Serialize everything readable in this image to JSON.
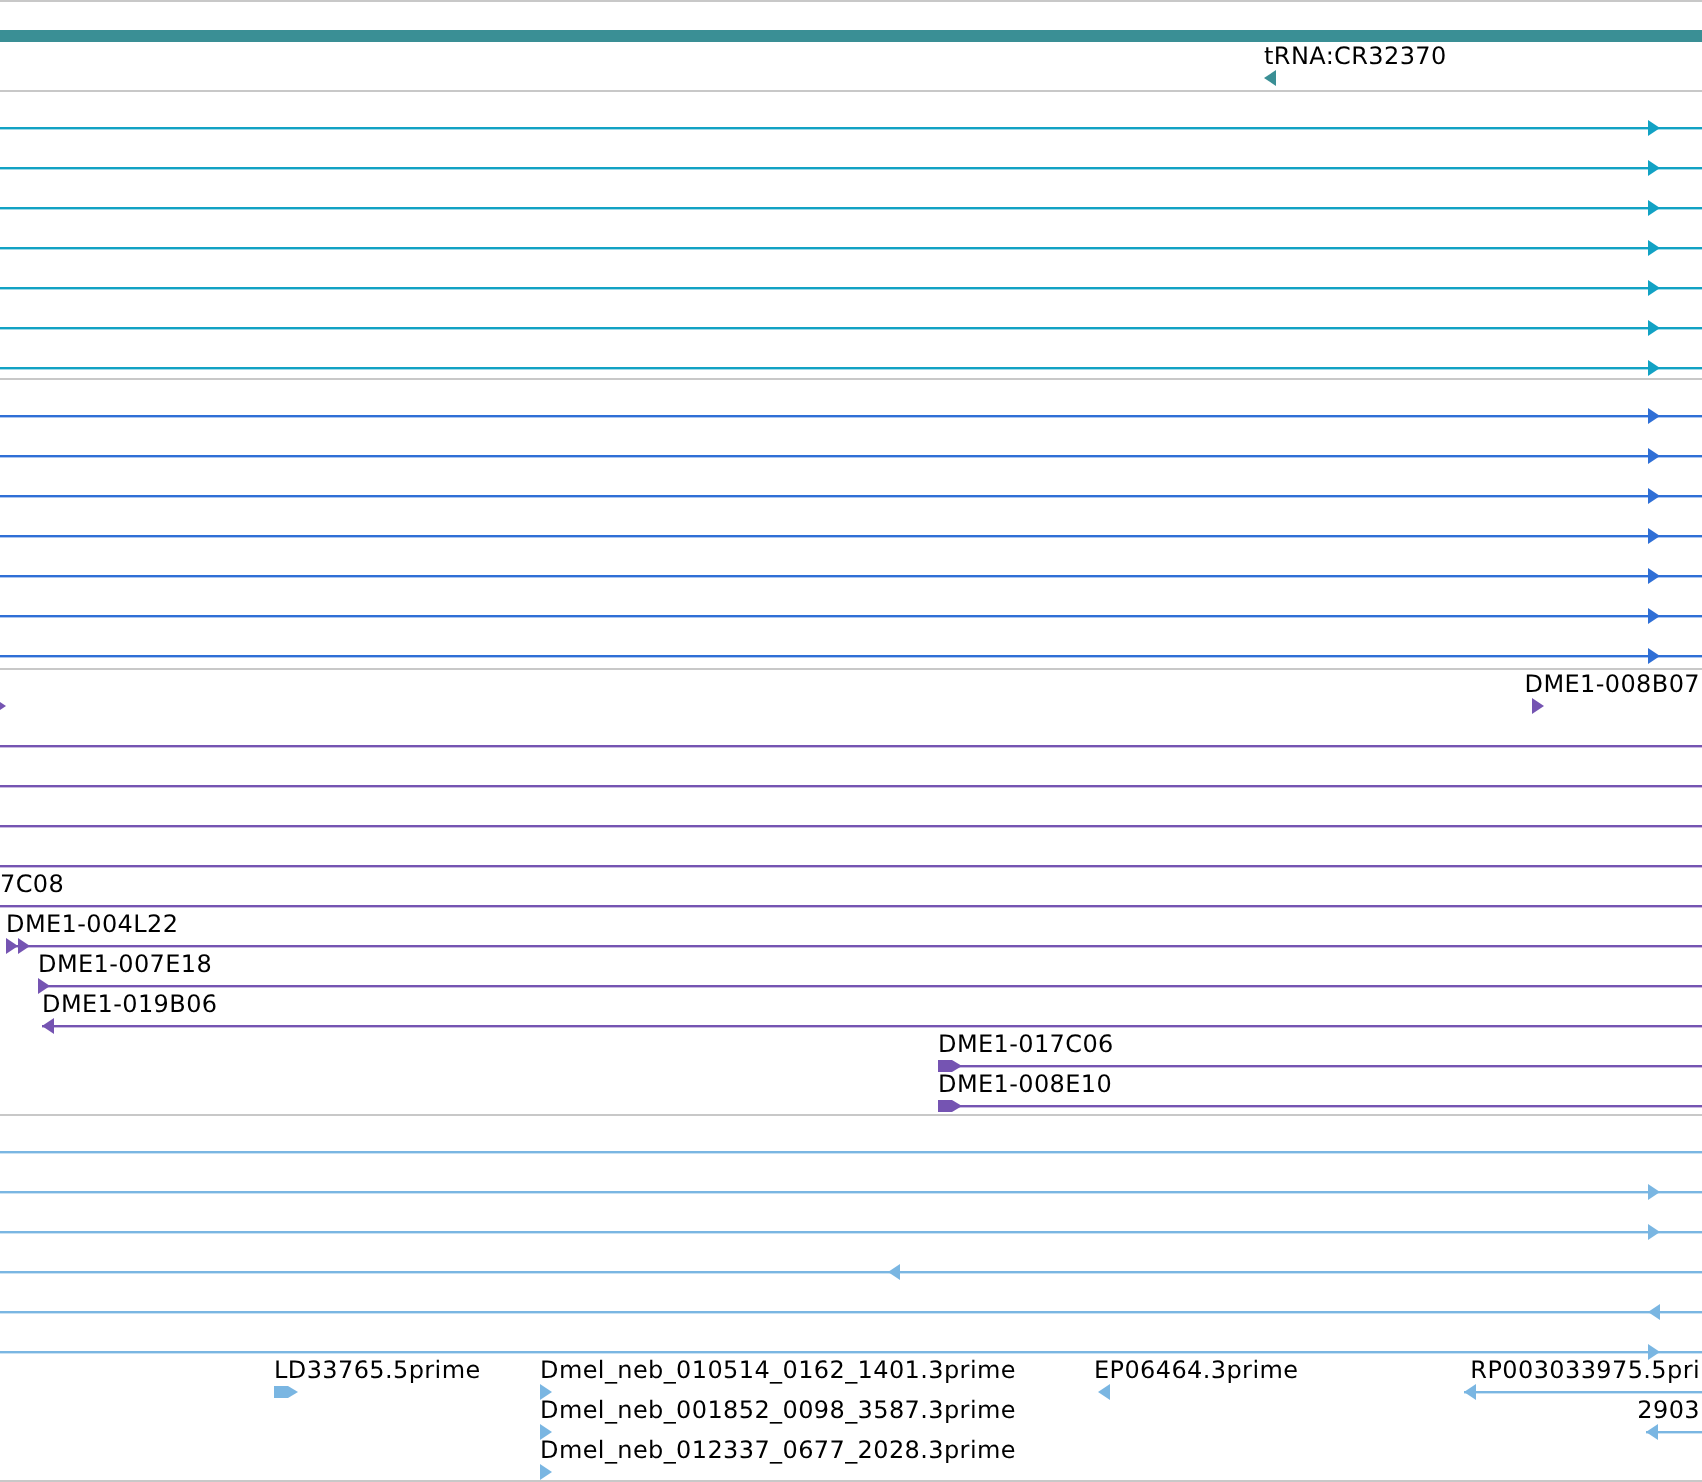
{
  "tracks": [
    {
      "color": "#3a8f95",
      "rows": [
        {
          "features": [
            {
              "kind": "bar"
            }
          ]
        },
        {
          "features": [
            {
              "kind": "reverse-glyph",
              "label": "tRNA:CR32370"
            }
          ]
        }
      ]
    },
    {
      "color": "#12a2c4",
      "rows": [
        {
          "features": [
            {
              "kind": "forward-line"
            }
          ]
        },
        {
          "features": [
            {
              "kind": "forward-line"
            }
          ]
        },
        {
          "features": [
            {
              "kind": "forward-line"
            }
          ]
        },
        {
          "features": [
            {
              "kind": "forward-line"
            }
          ]
        },
        {
          "features": [
            {
              "kind": "forward-line"
            }
          ]
        },
        {
          "features": [
            {
              "kind": "forward-line"
            }
          ]
        },
        {
          "features": [
            {
              "kind": "forward-line"
            }
          ]
        }
      ]
    },
    {
      "color": "#2f6fd6",
      "rows": [
        {
          "features": [
            {
              "kind": "forward-line"
            }
          ]
        },
        {
          "features": [
            {
              "kind": "forward-line"
            }
          ]
        },
        {
          "features": [
            {
              "kind": "forward-line"
            }
          ]
        },
        {
          "features": [
            {
              "kind": "forward-line"
            }
          ]
        },
        {
          "features": [
            {
              "kind": "forward-line"
            }
          ]
        },
        {
          "features": [
            {
              "kind": "forward-line"
            }
          ]
        },
        {
          "features": [
            {
              "kind": "forward-line"
            }
          ]
        }
      ]
    },
    {
      "color": "#7554b2",
      "rows": [
        {
          "features": [
            {
              "kind": "forward-glyph"
            },
            {
              "kind": "forward-glyph",
              "label": "DME1-008B07"
            }
          ]
        },
        {
          "features": [
            {
              "kind": "plain-line"
            }
          ]
        },
        {
          "features": [
            {
              "kind": "plain-line"
            }
          ]
        },
        {
          "features": [
            {
              "kind": "plain-line"
            }
          ]
        },
        {
          "features": [
            {
              "kind": "plain-line"
            }
          ]
        },
        {
          "features": [
            {
              "kind": "plain-line",
              "label": "7C08"
            }
          ]
        },
        {
          "features": [
            {
              "kind": "forward-line",
              "label": "DME1-004L22"
            }
          ]
        },
        {
          "features": [
            {
              "kind": "forward-line",
              "label": "DME1-007E18"
            }
          ]
        },
        {
          "features": [
            {
              "kind": "reverse-line",
              "label": "DME1-019B06"
            }
          ]
        },
        {
          "features": [
            {
              "kind": "forward-line",
              "label": "DME1-017C06"
            }
          ]
        },
        {
          "features": [
            {
              "kind": "forward-line",
              "label": "DME1-008E10"
            }
          ]
        }
      ]
    },
    {
      "color": "#7ab6e2",
      "rows": [
        {
          "features": [
            {
              "kind": "plain-line"
            }
          ]
        },
        {
          "features": [
            {
              "kind": "forward-line"
            }
          ]
        },
        {
          "features": [
            {
              "kind": "forward-line"
            }
          ]
        },
        {
          "features": [
            {
              "kind": "reverse-line"
            }
          ]
        },
        {
          "features": [
            {
              "kind": "reverse-line"
            }
          ]
        },
        {
          "features": [
            {
              "kind": "forward-line"
            }
          ]
        },
        {
          "features": [
            {
              "kind": "forward-glyph",
              "label": "LD33765.5prime"
            },
            {
              "kind": "forward-glyph",
              "label": "Dmel_neb_010514_0162_1401.3prime"
            },
            {
              "kind": "reverse-glyph",
              "label": "EP06464.3prime"
            },
            {
              "kind": "reverse-line",
              "label": "RP003033975.5pri"
            }
          ]
        },
        {
          "features": [
            {
              "kind": "forward-glyph",
              "label": "Dmel_neb_001852_0098_3587.3prime"
            },
            {
              "kind": "reverse-line",
              "label": "2903"
            }
          ]
        },
        {
          "features": [
            {
              "kind": "forward-glyph",
              "label": "Dmel_neb_012337_0677_2028.3prime"
            }
          ]
        }
      ]
    }
  ]
}
